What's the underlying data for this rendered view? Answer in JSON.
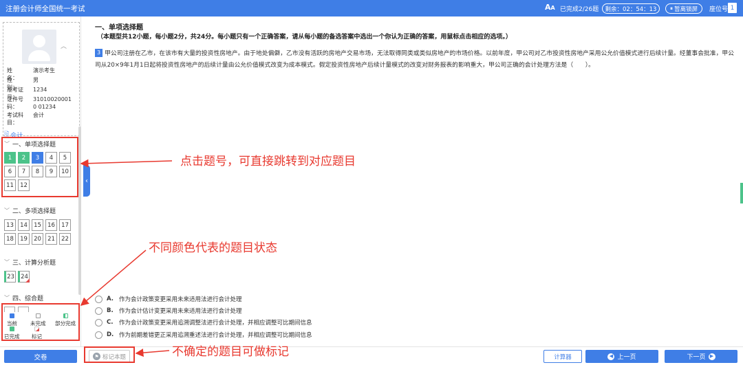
{
  "header": {
    "title": "注册会计师全国统一考试",
    "font_toggle": "A",
    "progress": "已完成2/26题",
    "timer": "剩余：02：54：13",
    "pause_label": "暂离锁屏",
    "seat_label": "座位号",
    "seat_number": "1"
  },
  "profile": {
    "fields": [
      {
        "k": "姓　　名：",
        "v": "演示考生"
      },
      {
        "k": "性　　别：",
        "v": "男"
      },
      {
        "k": "准考证号：",
        "v": "1234"
      },
      {
        "k": "证件号码：",
        "v": "310100200010 01234"
      },
      {
        "k": "考试科目：",
        "v": "会计"
      }
    ]
  },
  "nav": {
    "subject": "会计",
    "sections": [
      {
        "label": "一、单项选择题",
        "items": [
          {
            "n": "1",
            "state": "done"
          },
          {
            "n": "2",
            "state": "done"
          },
          {
            "n": "3",
            "state": "current"
          },
          {
            "n": "4",
            "state": "unfinished"
          },
          {
            "n": "5",
            "state": "unfinished"
          },
          {
            "n": "6",
            "state": "unfinished"
          },
          {
            "n": "7",
            "state": "unfinished"
          },
          {
            "n": "8",
            "state": "unfinished"
          },
          {
            "n": "9",
            "state": "unfinished"
          },
          {
            "n": "10",
            "state": "unfinished"
          },
          {
            "n": "11",
            "state": "unfinished"
          },
          {
            "n": "12",
            "state": "unfinished"
          }
        ]
      },
      {
        "label": "二、多项选择题",
        "items": [
          {
            "n": "13",
            "state": "unfinished"
          },
          {
            "n": "14",
            "state": "unfinished"
          },
          {
            "n": "15",
            "state": "unfinished"
          },
          {
            "n": "16",
            "state": "unfinished"
          },
          {
            "n": "17",
            "state": "unfinished"
          },
          {
            "n": "18",
            "state": "unfinished"
          },
          {
            "n": "19",
            "state": "unfinished"
          },
          {
            "n": "20",
            "state": "unfinished"
          },
          {
            "n": "21",
            "state": "unfinished"
          },
          {
            "n": "22",
            "state": "unfinished"
          }
        ]
      },
      {
        "label": "三、计算分析题",
        "items": [
          {
            "n": "23",
            "state": "partial"
          },
          {
            "n": "24",
            "state": "marked"
          }
        ]
      },
      {
        "label": "四、综合题",
        "items": []
      }
    ]
  },
  "legend": {
    "current": "当前",
    "unfinished": "未完成",
    "partial": "部分完成",
    "done": "已完成",
    "marked": "标记"
  },
  "main": {
    "section_title": "一、单项选择题",
    "section_desc": "（本题型共12小题，每小题2分，共24分。每小题只有一个正确答案，请从每小题的备选答案中选出一个你认为正确的答案，用鼠标点击相应的选项。）",
    "question_number": "3",
    "question_text": "甲公司注册在乙市，在该市有大量的投资性房地产。由于地处偏僻，乙市没有活跃的房地产交易市场，无法取得同类或类似房地产的市场价格。以前年度，甲公司对乙市投资性房地产采用公允价值模式进行后续计量。经董事会批准，甲公司从20×9年1月1日起将投资性房地产的后续计量由公允价值模式改变为成本模式。假定投资性房地产后续计量模式的改变对财务报表的影响重大，甲公司正确的会计处理方法是（　　）。",
    "options": [
      {
        "letter": "A.",
        "text": "作为会计政策变更采用未来适用法进行会计处理"
      },
      {
        "letter": "B.",
        "text": "作为会计估计变更采用未来适用法进行会计处理"
      },
      {
        "letter": "C.",
        "text": "作为会计政策变更采用追溯调整法进行会计处理，并相应调整可比期间信息"
      },
      {
        "letter": "D.",
        "text": "作为前期差错更正采用追溯重述法进行会计处理，并相应调整可比期间信息"
      }
    ]
  },
  "footer": {
    "submit": "交卷",
    "mark": "标记本题",
    "calculator": "计算器",
    "prev": "上一页",
    "next": "下一页"
  },
  "annotations": {
    "jump": "点击题号，可直接跳转到对应题目",
    "colors": "不同颜色代表的题目状态",
    "mark": "不确定的题目可做标记"
  }
}
